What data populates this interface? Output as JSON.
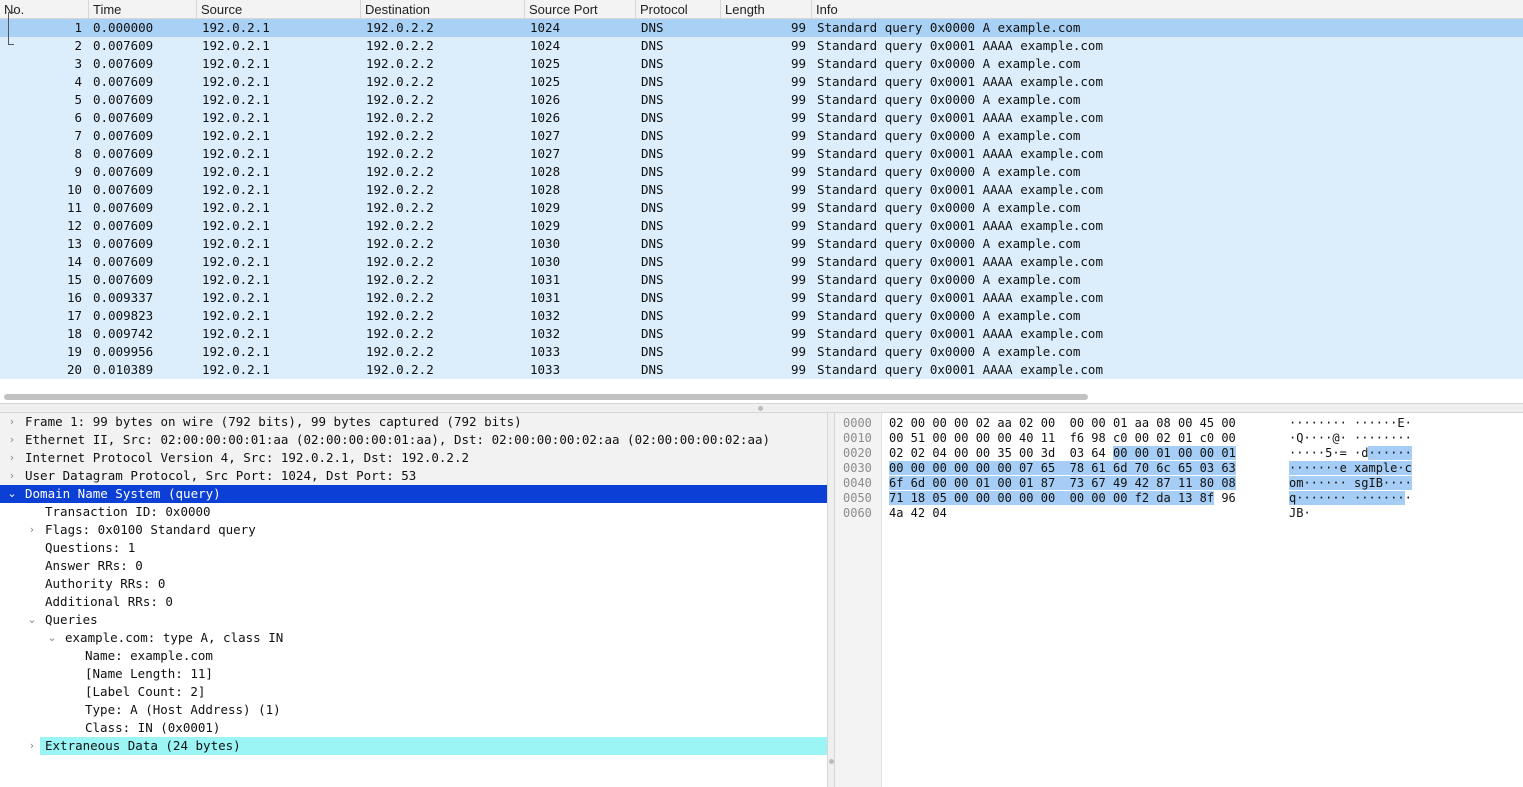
{
  "colors": {
    "row_bg": "#dceefc",
    "row_selected_bg": "#a9d1f5",
    "detail_selected_bg": "#0b3fd6",
    "extraneous_bg": "#9bf5f5",
    "bytes_highlight": "#a6cdf5"
  },
  "columns": {
    "no": "No.",
    "time": "Time",
    "source": "Source",
    "destination": "Destination",
    "source_port": "Source Port",
    "protocol": "Protocol",
    "length": "Length",
    "info": "Info"
  },
  "packets": [
    {
      "no": "1",
      "time": "0.000000",
      "src": "192.0.2.1",
      "dst": "192.0.2.2",
      "sport": "1024",
      "proto": "DNS",
      "len": "99",
      "info": "Standard query 0x0000 A example.com"
    },
    {
      "no": "2",
      "time": "0.007609",
      "src": "192.0.2.1",
      "dst": "192.0.2.2",
      "sport": "1024",
      "proto": "DNS",
      "len": "99",
      "info": "Standard query 0x0001 AAAA example.com"
    },
    {
      "no": "3",
      "time": "0.007609",
      "src": "192.0.2.1",
      "dst": "192.0.2.2",
      "sport": "1025",
      "proto": "DNS",
      "len": "99",
      "info": "Standard query 0x0000 A example.com"
    },
    {
      "no": "4",
      "time": "0.007609",
      "src": "192.0.2.1",
      "dst": "192.0.2.2",
      "sport": "1025",
      "proto": "DNS",
      "len": "99",
      "info": "Standard query 0x0001 AAAA example.com"
    },
    {
      "no": "5",
      "time": "0.007609",
      "src": "192.0.2.1",
      "dst": "192.0.2.2",
      "sport": "1026",
      "proto": "DNS",
      "len": "99",
      "info": "Standard query 0x0000 A example.com"
    },
    {
      "no": "6",
      "time": "0.007609",
      "src": "192.0.2.1",
      "dst": "192.0.2.2",
      "sport": "1026",
      "proto": "DNS",
      "len": "99",
      "info": "Standard query 0x0001 AAAA example.com"
    },
    {
      "no": "7",
      "time": "0.007609",
      "src": "192.0.2.1",
      "dst": "192.0.2.2",
      "sport": "1027",
      "proto": "DNS",
      "len": "99",
      "info": "Standard query 0x0000 A example.com"
    },
    {
      "no": "8",
      "time": "0.007609",
      "src": "192.0.2.1",
      "dst": "192.0.2.2",
      "sport": "1027",
      "proto": "DNS",
      "len": "99",
      "info": "Standard query 0x0001 AAAA example.com"
    },
    {
      "no": "9",
      "time": "0.007609",
      "src": "192.0.2.1",
      "dst": "192.0.2.2",
      "sport": "1028",
      "proto": "DNS",
      "len": "99",
      "info": "Standard query 0x0000 A example.com"
    },
    {
      "no": "10",
      "time": "0.007609",
      "src": "192.0.2.1",
      "dst": "192.0.2.2",
      "sport": "1028",
      "proto": "DNS",
      "len": "99",
      "info": "Standard query 0x0001 AAAA example.com"
    },
    {
      "no": "11",
      "time": "0.007609",
      "src": "192.0.2.1",
      "dst": "192.0.2.2",
      "sport": "1029",
      "proto": "DNS",
      "len": "99",
      "info": "Standard query 0x0000 A example.com"
    },
    {
      "no": "12",
      "time": "0.007609",
      "src": "192.0.2.1",
      "dst": "192.0.2.2",
      "sport": "1029",
      "proto": "DNS",
      "len": "99",
      "info": "Standard query 0x0001 AAAA example.com"
    },
    {
      "no": "13",
      "time": "0.007609",
      "src": "192.0.2.1",
      "dst": "192.0.2.2",
      "sport": "1030",
      "proto": "DNS",
      "len": "99",
      "info": "Standard query 0x0000 A example.com"
    },
    {
      "no": "14",
      "time": "0.007609",
      "src": "192.0.2.1",
      "dst": "192.0.2.2",
      "sport": "1030",
      "proto": "DNS",
      "len": "99",
      "info": "Standard query 0x0001 AAAA example.com"
    },
    {
      "no": "15",
      "time": "0.007609",
      "src": "192.0.2.1",
      "dst": "192.0.2.2",
      "sport": "1031",
      "proto": "DNS",
      "len": "99",
      "info": "Standard query 0x0000 A example.com"
    },
    {
      "no": "16",
      "time": "0.009337",
      "src": "192.0.2.1",
      "dst": "192.0.2.2",
      "sport": "1031",
      "proto": "DNS",
      "len": "99",
      "info": "Standard query 0x0001 AAAA example.com"
    },
    {
      "no": "17",
      "time": "0.009823",
      "src": "192.0.2.1",
      "dst": "192.0.2.2",
      "sport": "1032",
      "proto": "DNS",
      "len": "99",
      "info": "Standard query 0x0000 A example.com"
    },
    {
      "no": "18",
      "time": "0.009742",
      "src": "192.0.2.1",
      "dst": "192.0.2.2",
      "sport": "1032",
      "proto": "DNS",
      "len": "99",
      "info": "Standard query 0x0001 AAAA example.com"
    },
    {
      "no": "19",
      "time": "0.009956",
      "src": "192.0.2.1",
      "dst": "192.0.2.2",
      "sport": "1033",
      "proto": "DNS",
      "len": "99",
      "info": "Standard query 0x0000 A example.com"
    },
    {
      "no": "20",
      "time": "0.010389",
      "src": "192.0.2.1",
      "dst": "192.0.2.2",
      "sport": "1033",
      "proto": "DNS",
      "len": "99",
      "info": "Standard query 0x0001 AAAA example.com"
    }
  ],
  "details": {
    "frame": "Frame 1: 99 bytes on wire (792 bits), 99 bytes captured (792 bits)",
    "ethernet": "Ethernet II, Src: 02:00:00:00:01:aa (02:00:00:00:01:aa), Dst: 02:00:00:00:02:aa (02:00:00:00:02:aa)",
    "ipv4": "Internet Protocol Version 4, Src: 192.0.2.1, Dst: 192.0.2.2",
    "udp": "User Datagram Protocol, Src Port: 1024, Dst Port: 53",
    "dns": "Domain Name System (query)",
    "transaction_id": "Transaction ID: 0x0000",
    "flags": "Flags: 0x0100 Standard query",
    "questions": "Questions: 1",
    "answer_rrs": "Answer RRs: 0",
    "authority_rrs": "Authority RRs: 0",
    "additional_rrs": "Additional RRs: 0",
    "queries": "Queries",
    "query": "example.com: type A, class IN",
    "name": "Name: example.com",
    "name_length": "[Name Length: 11]",
    "label_count": "[Label Count: 2]",
    "type": "Type: A (Host Address) (1)",
    "class": "Class: IN (0x0001)",
    "extraneous": "Extraneous Data (24 bytes)"
  },
  "bytes": [
    {
      "offset": "0000",
      "hex_pre": "02 00 00 00 02 aa 02 00  00 00 01 aa 08 00 45 00",
      "hex_hl": "",
      "hex_post": "",
      "asc_pre": "········ ······E·",
      "asc_hl": "",
      "asc_post": ""
    },
    {
      "offset": "0010",
      "hex_pre": "00 51 00 00 00 00 40 11  f6 98 c0 00 02 01 c0 00",
      "hex_hl": "",
      "hex_post": "",
      "asc_pre": "·Q····@· ········",
      "asc_hl": "",
      "asc_post": ""
    },
    {
      "offset": "0020",
      "hex_pre": "02 02 04 00 00 35 00 3d  03 64 ",
      "hex_hl": "00 00 01 00 00 01",
      "hex_post": "",
      "asc_pre": "·····5·= ·d",
      "asc_hl": "······",
      "asc_post": ""
    },
    {
      "offset": "0030",
      "hex_pre": "",
      "hex_hl": "00 00 00 00 00 00 07 65  78 61 6d 70 6c 65 03 63",
      "hex_post": "",
      "asc_pre": "",
      "asc_hl": "·······e xample·c",
      "asc_post": ""
    },
    {
      "offset": "0040",
      "hex_pre": "",
      "hex_hl": "6f 6d 00 00 01 00 01 87  73 67 49 42 87 11 80 08",
      "hex_post": "",
      "asc_pre": "",
      "asc_hl": "om······ sgIB····",
      "asc_post": ""
    },
    {
      "offset": "0050",
      "hex_pre": "",
      "hex_hl": "71 18 05 00 00 00 00 00  00 00 00 f2 da 13 8f",
      "hex_post": " 96",
      "asc_pre": "",
      "asc_hl": "q······· ·······",
      "asc_post": "·"
    },
    {
      "offset": "0060",
      "hex_pre": "4a 42 04",
      "hex_hl": "",
      "hex_post": "",
      "asc_pre": "JB·",
      "asc_hl": "",
      "asc_post": ""
    }
  ]
}
